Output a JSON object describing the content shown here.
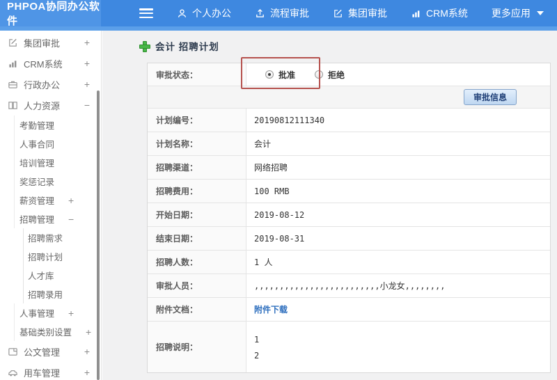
{
  "topbar": {
    "logo": "PHPOA协同办公软件",
    "nav": [
      {
        "label": "个人办公",
        "icon": "person-icon"
      },
      {
        "label": "流程审批",
        "icon": "export-icon"
      },
      {
        "label": "集团审批",
        "icon": "edit-icon"
      },
      {
        "label": "CRM系统",
        "icon": "bar-chart-icon"
      },
      {
        "label": "更多应用",
        "icon": "caret-down-icon"
      }
    ]
  },
  "sidebar": {
    "items": [
      {
        "label": "集团审批",
        "icon": "edit-icon",
        "expand": "+"
      },
      {
        "label": "CRM系统",
        "icon": "bar-chart-icon",
        "expand": "+"
      },
      {
        "label": "行政办公",
        "icon": "briefcase-icon",
        "expand": "+"
      },
      {
        "label": "人力资源",
        "icon": "book-icon",
        "expand": "−"
      },
      {
        "label": "考勤管理"
      },
      {
        "label": "人事合同"
      },
      {
        "label": "培训管理"
      },
      {
        "label": "奖惩记录"
      },
      {
        "label": "薪资管理",
        "expand": "+"
      },
      {
        "label": "招聘管理",
        "expand": "−"
      },
      {
        "label": "招聘需求"
      },
      {
        "label": "招聘计划"
      },
      {
        "label": "人才库"
      },
      {
        "label": "招聘录用"
      },
      {
        "label": "人事管理",
        "expand": "+"
      },
      {
        "label": "基础类别设置",
        "expand": "+"
      },
      {
        "label": "公文管理",
        "icon": "document-icon",
        "expand": "+"
      },
      {
        "label": "用车管理",
        "icon": "car-icon",
        "expand": "+"
      }
    ]
  },
  "main": {
    "title": "会计 招聘计划",
    "approval": {
      "label": "审批状态：",
      "options": [
        {
          "label": "批准",
          "checked": true
        },
        {
          "label": "拒绝",
          "checked": false
        }
      ]
    },
    "approval_info_button": "审批信息",
    "rows": [
      {
        "label": "计划编号：",
        "value": "20190812111340"
      },
      {
        "label": "计划名称：",
        "value": "会计"
      },
      {
        "label": "招聘渠道：",
        "value": "网络招聘"
      },
      {
        "label": "招聘费用：",
        "value": "100 RMB"
      },
      {
        "label": "开始日期：",
        "value": "2019-08-12"
      },
      {
        "label": "结束日期：",
        "value": "2019-08-31"
      },
      {
        "label": "招聘人数：",
        "value": "1 人"
      },
      {
        "label": "审批人员：",
        "value": ",,,,,,,,,,,,,,,,,,,,,,,,,小龙女,,,,,,,,"
      },
      {
        "label": "附件文档：",
        "link": "附件下载"
      },
      {
        "label": "招聘说明：",
        "lines": [
          "1",
          "2"
        ]
      }
    ]
  },
  "colors": {
    "topbar_blue": "#3e88e0",
    "accent_blue": "#5b9fe9",
    "plus_green": "#49b749",
    "annotation_red": "#b5514d",
    "link_blue": "#2e6fbe"
  }
}
